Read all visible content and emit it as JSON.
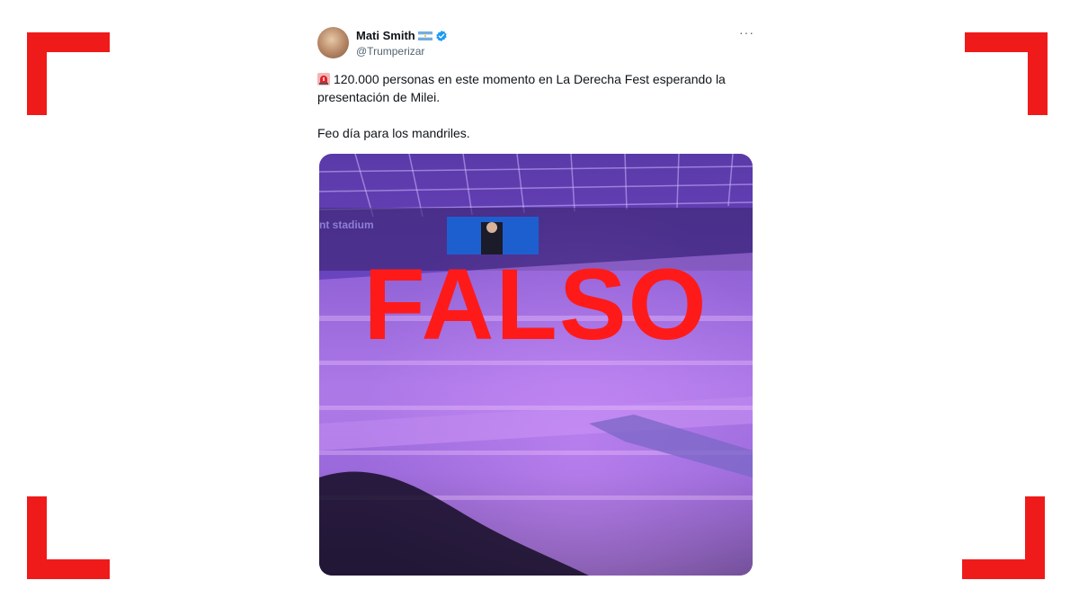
{
  "user": {
    "display_name": "Mati Smith",
    "handle": "@Trumperizar"
  },
  "tweet": {
    "line1": "120.000 personas en este momento en La Derecha Fest esperando la presentación de Milei.",
    "line2": "Feo día para los mandriles."
  },
  "media": {
    "stamp": "FALSO",
    "sign_text": "nt stadium"
  },
  "icons": {
    "more": "more-options-icon",
    "verified": "verified-badge-icon",
    "flag": "argentina-flag-icon",
    "siren": "siren-emoji-icon"
  },
  "colors": {
    "corner_marks": "#ef1b1b",
    "stamp": "#ff1a1a",
    "verified": "#1d9bf0"
  }
}
